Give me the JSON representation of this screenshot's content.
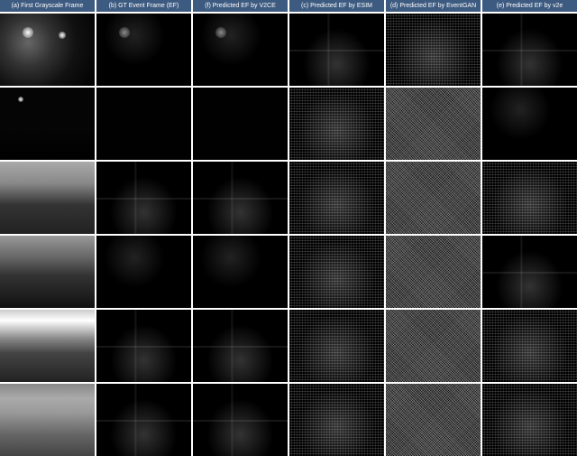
{
  "columns": [
    {
      "id": "a",
      "label": "(a) First Grayscale Frame"
    },
    {
      "id": "b",
      "label": "(b) GT Event Frame (EF)"
    },
    {
      "id": "c",
      "label": "(f) Predicted EF by V2CE"
    },
    {
      "id": "d",
      "label": "(c) Predicted EF by ESIM"
    },
    {
      "id": "e",
      "label": "(d) Predicted EF by EventGAN"
    },
    {
      "id": "f",
      "label": "(e) Predicted EF by v2e"
    }
  ],
  "rows": [
    {
      "scene": "night-street-lights",
      "cells": [
        {
          "col": "a",
          "class": "scene-gray-1",
          "desc": "night street grayscale with streetlights"
        },
        {
          "col": "b",
          "class": "scene-dark-sparse",
          "desc": "sparse ground truth events"
        },
        {
          "col": "c",
          "class": "scene-dark-sparse",
          "desc": "V2CE sparse events"
        },
        {
          "col": "d",
          "class": "scene-edge",
          "desc": "ESIM edge-like events"
        },
        {
          "col": "e",
          "class": "scene-noisy",
          "desc": "EventGAN noisy output"
        },
        {
          "col": "f",
          "class": "scene-edge",
          "desc": "v2e edge events"
        }
      ]
    },
    {
      "scene": "dark-road",
      "cells": [
        {
          "col": "a",
          "class": "scene-gray-2",
          "desc": "very dark road grayscale"
        },
        {
          "col": "b",
          "class": "scene-dark",
          "desc": "very sparse GT events"
        },
        {
          "col": "c",
          "class": "scene-dark",
          "desc": "V2CE very sparse"
        },
        {
          "col": "d",
          "class": "scene-noisy",
          "desc": "ESIM noisy"
        },
        {
          "col": "e",
          "class": "scene-noisy-dense",
          "desc": "EventGAN dense noise"
        },
        {
          "col": "f",
          "class": "scene-dark-sparse",
          "desc": "v2e sparse"
        }
      ]
    },
    {
      "scene": "sunset-road",
      "cells": [
        {
          "col": "a",
          "class": "scene-gray-3",
          "desc": "sunset road with clouds grayscale"
        },
        {
          "col": "b",
          "class": "scene-edge",
          "desc": "GT event edges"
        },
        {
          "col": "c",
          "class": "scene-edge",
          "desc": "V2CE edges"
        },
        {
          "col": "d",
          "class": "scene-noisy",
          "desc": "ESIM noisy edges"
        },
        {
          "col": "e",
          "class": "scene-noisy-dense",
          "desc": "EventGAN dense"
        },
        {
          "col": "f",
          "class": "scene-noisy",
          "desc": "v2e edges"
        }
      ]
    },
    {
      "scene": "road-horizon",
      "cells": [
        {
          "col": "a",
          "class": "scene-gray-4",
          "desc": "road horizon grayscale"
        },
        {
          "col": "b",
          "class": "scene-dark-sparse",
          "desc": "GT sparse events"
        },
        {
          "col": "c",
          "class": "scene-dark-sparse",
          "desc": "V2CE sparse"
        },
        {
          "col": "d",
          "class": "scene-noisy",
          "desc": "ESIM noisy"
        },
        {
          "col": "e",
          "class": "scene-noisy-dense",
          "desc": "EventGAN very noisy"
        },
        {
          "col": "f",
          "class": "scene-edge",
          "desc": "v2e edges"
        }
      ]
    },
    {
      "scene": "building-sky",
      "cells": [
        {
          "col": "a",
          "class": "scene-gray-5",
          "desc": "building sky grayscale"
        },
        {
          "col": "b",
          "class": "scene-edge",
          "desc": "GT edges"
        },
        {
          "col": "c",
          "class": "scene-edge",
          "desc": "V2CE edges"
        },
        {
          "col": "d",
          "class": "scene-noisy",
          "desc": "ESIM noisy"
        },
        {
          "col": "e",
          "class": "scene-noisy-dense",
          "desc": "EventGAN dense"
        },
        {
          "col": "f",
          "class": "scene-noisy",
          "desc": "v2e noisy"
        }
      ]
    },
    {
      "scene": "indoor-floor",
      "cells": [
        {
          "col": "a",
          "class": "scene-gray-6",
          "desc": "indoor floor grayscale"
        },
        {
          "col": "b",
          "class": "scene-edge",
          "desc": "GT edges"
        },
        {
          "col": "c",
          "class": "scene-edge",
          "desc": "V2CE edges"
        },
        {
          "col": "d",
          "class": "scene-noisy",
          "desc": "ESIM noisy"
        },
        {
          "col": "e",
          "class": "scene-noisy-dense",
          "desc": "EventGAN dense"
        },
        {
          "col": "f",
          "class": "scene-noisy",
          "desc": "v2e noisy"
        }
      ]
    }
  ]
}
